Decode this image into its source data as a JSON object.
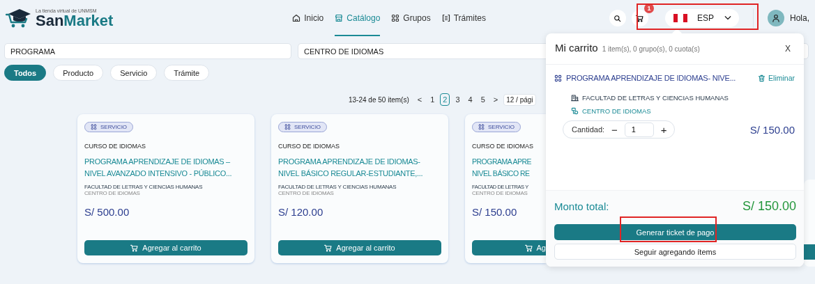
{
  "header": {
    "logo": {
      "tagline": "La tienda virtual de UNMSM",
      "name_start": "San",
      "name_end": "Market"
    },
    "nav": [
      {
        "label": "Inicio",
        "selected": false
      },
      {
        "label": "Catálogo",
        "selected": true
      },
      {
        "label": "Grupos",
        "selected": false
      },
      {
        "label": "Trámites",
        "selected": false
      }
    ],
    "cart_badge": "1",
    "language": "ESP",
    "greeting": "Hola,"
  },
  "filters": {
    "fields": [
      {
        "value": "PROGRAMA"
      },
      {
        "value": "CENTRO DE IDIOMAS"
      }
    ],
    "chips": [
      {
        "label": "Todos",
        "selected": true
      },
      {
        "label": "Producto",
        "selected": false
      },
      {
        "label": "Servicio",
        "selected": false
      },
      {
        "label": "Trámite",
        "selected": false
      }
    ]
  },
  "pagination": {
    "summary": "13-24 de 50 item(s)",
    "prev": "<",
    "pages": [
      {
        "label": "1",
        "selected": false
      },
      {
        "label": "2",
        "selected": true
      },
      {
        "label": "3",
        "selected": false
      },
      {
        "label": "4",
        "selected": false
      },
      {
        "label": "5",
        "selected": false
      }
    ],
    "next": ">",
    "page_size": "12 / pági"
  },
  "cards": [
    {
      "tag": "SERVICIO",
      "category": "CURSO DE IDIOMAS",
      "title_lines": [
        "PROGRAMA APRENDIZAJE DE IDIOMAS –",
        "NIVEL AVANZADO INTENSIVO - PÚBLICO..."
      ],
      "faculty": "FACULTAD DE LETRAS Y CIENCIAS HUMANAS",
      "unit": "CENTRO DE IDIOMAS",
      "price": "S/ 500.00",
      "button": "Agregar al carrito",
      "clipped": false
    },
    {
      "tag": "SERVICIO",
      "category": "CURSO DE IDIOMAS",
      "title_lines": [
        "PROGRAMA APRENDIZAJE DE IDIOMAS-",
        "NIVEL BÁSICO REGULAR-ESTUDIANTE,..."
      ],
      "faculty": "FACULTAD DE LETRAS Y CIENCIAS HUMANAS",
      "unit": "CENTRO DE IDIOMAS",
      "price": "S/ 120.00",
      "button": "Agregar al carrito",
      "clipped": false
    },
    {
      "tag": "SERVICIO",
      "category": "CURSO DE IDIOMAS",
      "title_lines": [
        "PROGRAMA APRE",
        "NIVEL BÁSICO RE"
      ],
      "faculty": "FACULTAD DE LETRAS Y",
      "unit": "CENTRO DE IDIOMAS",
      "price": "S/ 150.00",
      "button": "Ag",
      "clipped": true
    }
  ],
  "cart": {
    "title": "Mi carrito",
    "summary": "1 item(s), 0 grupo(s), 0 cuota(s)",
    "close": "X",
    "items": [
      {
        "name": "PROGRAMA APRENDIZAJE DE IDIOMAS- NIVE...",
        "remove": "Eliminar",
        "faculty": "FACULTAD DE LETRAS Y CIENCIAS HUMANAS",
        "unit": "CENTRO DE IDIOMAS",
        "quantity_label": "Cantidad:",
        "minus": "−",
        "quantity": "1",
        "plus": "+",
        "price": "S/ 150.00"
      }
    ],
    "total_label": "Monto total:",
    "total": "S/ 150.00",
    "checkout": "Generar ticket de pago",
    "continue": "Seguir agregando ítems"
  }
}
